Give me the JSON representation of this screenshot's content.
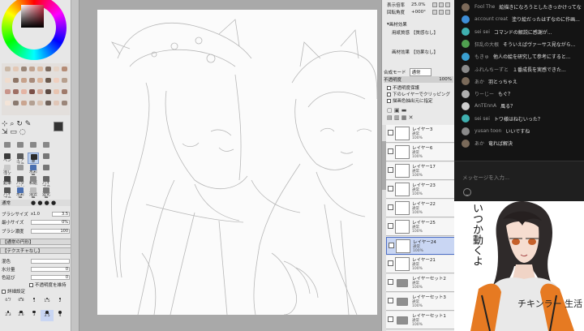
{
  "left_panel": {
    "tools": [
      {
        "label": "",
        "selected": false
      },
      {
        "label": "",
        "selected": false
      },
      {
        "label": "",
        "selected": false
      },
      {
        "label": "",
        "selected": false
      },
      {
        "label": "ペン",
        "selected": false
      },
      {
        "label": "エアブラ",
        "selected": false
      },
      {
        "label": "筆",
        "selected": true
      },
      {
        "label": "",
        "selected": false
      },
      {
        "label": "消しゴム",
        "selected": false
      },
      {
        "label": "",
        "selected": false
      },
      {
        "label": "水彩筆",
        "selected": false
      },
      {
        "label": "",
        "selected": false
      },
      {
        "label": "鉛筆",
        "selected": false
      },
      {
        "label": "パターン",
        "selected": false
      },
      {
        "label": "和紙",
        "selected": false
      },
      {
        "label": "ハイブラシ",
        "selected": false
      },
      {
        "label": "ハイプラ",
        "selected": false
      },
      {
        "label": "水彩筆",
        "selected": false
      },
      {
        "label": "消去筆",
        "selected": false
      },
      {
        "label": "濃化筆",
        "selected": false
      }
    ],
    "blend_label": "通常",
    "brush_size_label": "ブラシサイズ",
    "brush_size_mult": "x1.0",
    "brush_size_value": "3.5",
    "min_size_label": "最小サイズ",
    "min_size_value": "0%",
    "density_label": "ブラシ濃度",
    "density_value": "100",
    "shape_label": "【通常の円形】",
    "texture_label": "【テクスチャなし】",
    "blend2_label": "混色",
    "water_label": "水分量",
    "water_value": "0",
    "color_ext_label": "色延び",
    "color_ext_value": "0",
    "keep_opacity_label": "不透明度を維持",
    "detail_label": "詳細設定",
    "brush_sizes": [
      "0.7",
      "0.8",
      "1",
      "1.5",
      "2",
      "2.3",
      "2.6",
      "3",
      "3.5",
      "4"
    ]
  },
  "right_panel": {
    "display_label": "表示倍率",
    "display_value": "25.0%",
    "rotation_label": "回転角度",
    "rotation_value": "+000°",
    "effects_header": "画材効果",
    "paper_label": "用紙質感",
    "paper_value": "【質感なし】",
    "material_label": "画材効果",
    "material_value": "【効果なし】",
    "blend_mode_label": "合成モード",
    "blend_mode_value": "通常",
    "opacity_label": "不透明度",
    "opacity_value": "100%",
    "protect_label": "不透明度保護",
    "clip_label": "下のレイヤーでクリッピング",
    "select_src_label": "描画色抽出元に指定",
    "layers": [
      {
        "name": "レイヤー3",
        "mode": "通常",
        "opacity": "100%",
        "type": "layer",
        "selected": false
      },
      {
        "name": "レイヤー6",
        "mode": "通常",
        "opacity": "100%",
        "type": "layer",
        "selected": false
      },
      {
        "name": "レイヤー17",
        "mode": "通常",
        "opacity": "100%",
        "type": "layer",
        "selected": false
      },
      {
        "name": "レイヤー23",
        "mode": "通常",
        "opacity": "100%",
        "type": "layer",
        "selected": false
      },
      {
        "name": "レイヤー22",
        "mode": "通常",
        "opacity": "100%",
        "type": "layer",
        "selected": false
      },
      {
        "name": "レイヤー25",
        "mode": "通常",
        "opacity": "100%",
        "type": "layer",
        "selected": false
      },
      {
        "name": "レイヤー24",
        "mode": "通常",
        "opacity": "100%",
        "type": "layer",
        "selected": true
      },
      {
        "name": "レイヤー21",
        "mode": "通常",
        "opacity": "100%",
        "type": "layer",
        "selected": false
      },
      {
        "name": "レイヤーセット2",
        "mode": "通常",
        "opacity": "100%",
        "type": "folder",
        "selected": false
      },
      {
        "name": "レイヤーセット3",
        "mode": "通常",
        "opacity": "100%",
        "type": "folder",
        "selected": false
      },
      {
        "name": "レイヤーセット1",
        "mode": "通常",
        "opacity": "100%",
        "type": "folder",
        "selected": false
      }
    ]
  },
  "chat": {
    "messages": [
      {
        "name": "Fool The",
        "text": "絵描きになろうとしたきっかけってな",
        "avatar_color": "#7c6a5a"
      },
      {
        "name": "account creat",
        "text": "塗り絵だったはずなのに作画...",
        "avatar_color": "#3e8ed8"
      },
      {
        "name": "sei sei",
        "text": "コマンドの解説に感謝が...",
        "avatar_color": "#3fb0b0"
      },
      {
        "name": "狂乱の大根",
        "text": "そういえばヴァーサス見ながら...",
        "avatar_color": "#50a050"
      },
      {
        "name": "もきゅ",
        "text": "他人の絵を研究して参考にすると...",
        "avatar_color": "#3a9fd0"
      },
      {
        "name": "ふれんちーずと",
        "text": "１番成長を実感できた...",
        "avatar_color": "#8b8b8b"
      },
      {
        "name": "あか",
        "text": "羽とっちゃえ",
        "avatar_color": "#7a6a5a"
      },
      {
        "name": "りーじー",
        "text": "もぐ？",
        "avatar_color": "#b0b0b0"
      },
      {
        "name": "AnTEnnA",
        "text": "風る？",
        "avatar_color": "#cfcfcf"
      },
      {
        "name": "sei sei",
        "text": "トワ様はねむいった？",
        "avatar_color": "#3fb0b0"
      },
      {
        "name": "yusan toon",
        "text": "いいですね",
        "avatar_color": "#8a8a8a"
      },
      {
        "name": "あか",
        "text": "竜れば解決",
        "avatar_color": "#7a6a5a"
      }
    ],
    "input_placeholder": "メッセージを入力...",
    "vtuber_caption": "いつか動くよ",
    "shirt_text": "チキンラー 生活"
  }
}
